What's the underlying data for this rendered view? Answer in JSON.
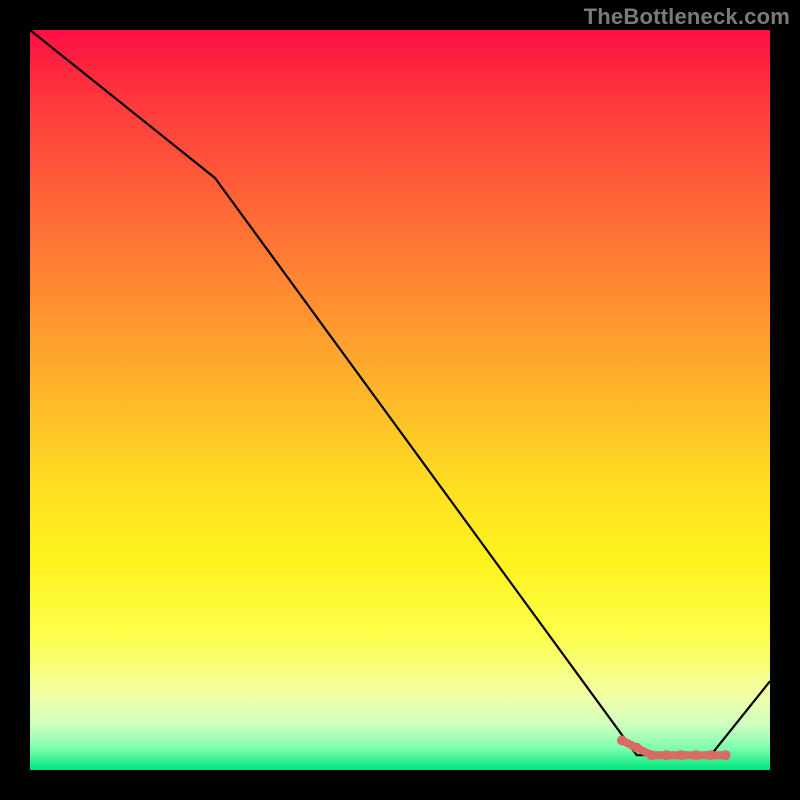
{
  "watermark": "TheBottleneck.com",
  "chart_data": {
    "type": "line",
    "title": "",
    "xlabel": "",
    "ylabel": "",
    "xlim": [
      0,
      100
    ],
    "ylim": [
      0,
      100
    ],
    "x": [
      0,
      25,
      82,
      92,
      100
    ],
    "values": [
      100,
      80,
      2,
      2,
      12
    ],
    "highlight": {
      "x": [
        80,
        82,
        84,
        86,
        88,
        90,
        92,
        94
      ],
      "values": [
        4,
        3,
        2,
        2,
        2,
        2,
        2,
        2
      ]
    },
    "background_gradient": {
      "top": "#ff0f43",
      "mid": "#fff31f",
      "bottom": "#00e681"
    }
  }
}
